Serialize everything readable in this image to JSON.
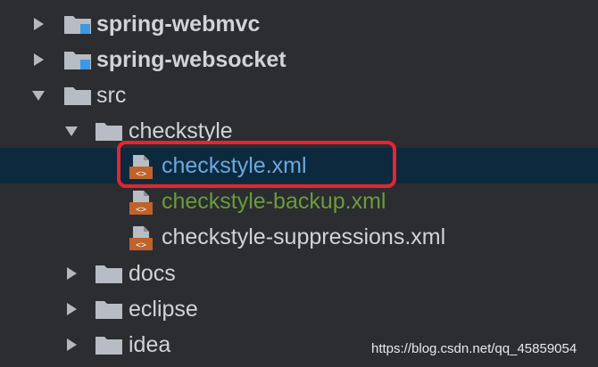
{
  "project_tree": {
    "items": [
      {
        "label": "spring-webmvc",
        "type": "module"
      },
      {
        "label": "spring-websocket",
        "type": "module"
      },
      {
        "label": "src",
        "type": "folder",
        "expanded": true
      },
      {
        "label": "checkstyle",
        "type": "folder",
        "expanded": true
      },
      {
        "label": "checkstyle.xml",
        "type": "xml-file",
        "selected": true
      },
      {
        "label": "checkstyle-backup.xml",
        "type": "xml-file"
      },
      {
        "label": "checkstyle-suppressions.xml",
        "type": "xml-file"
      },
      {
        "label": "docs",
        "type": "folder"
      },
      {
        "label": "eclipse",
        "type": "folder"
      },
      {
        "label": "idea",
        "type": "folder"
      }
    ]
  },
  "watermark": "https://blog.csdn.net/qq_45859054",
  "colors": {
    "background": "#2b2d30",
    "selection": "#0d293e",
    "highlight_border": "#e32534",
    "folder": "#b8bcc4",
    "module_badge": "#3f98e0",
    "xml_badge": "#c0622b"
  }
}
